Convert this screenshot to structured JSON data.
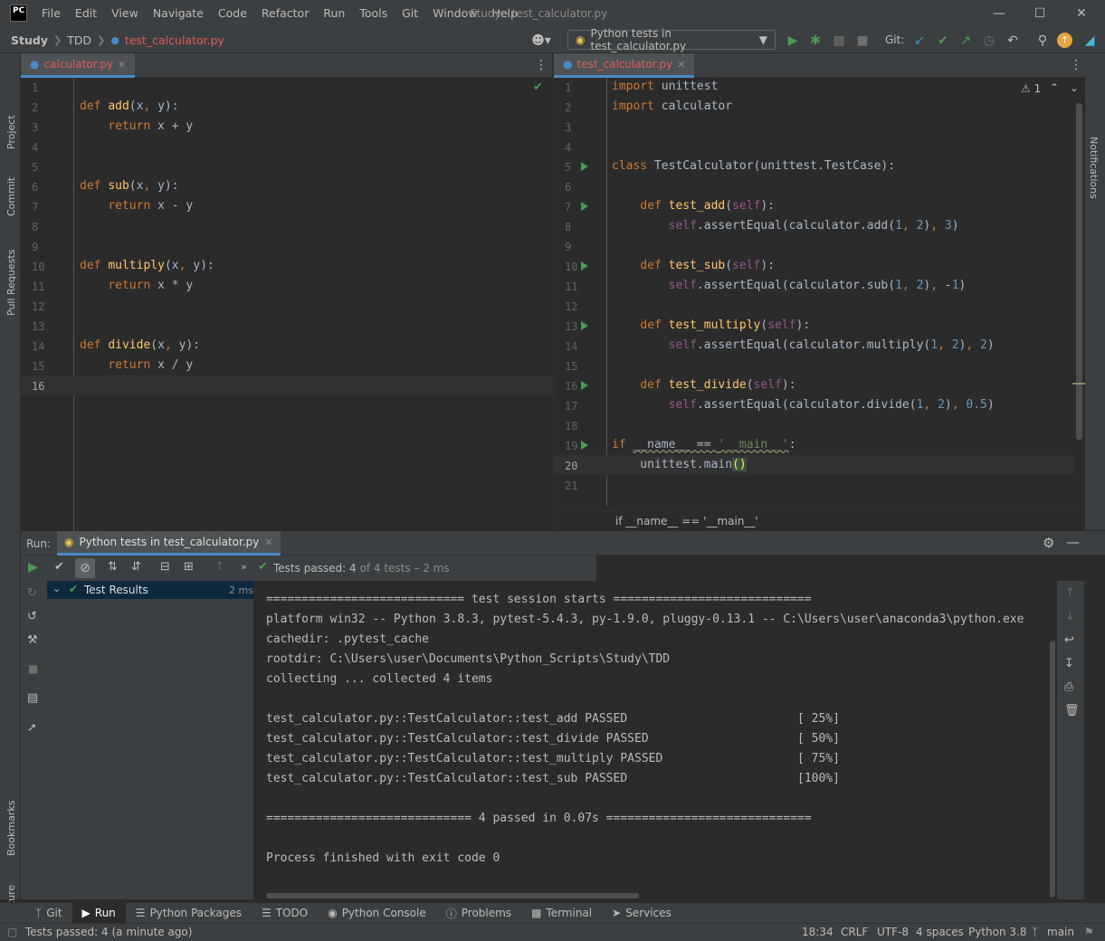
{
  "window": {
    "logo": "PC",
    "title": "Study - test_calculator.py",
    "menu": [
      "File",
      "Edit",
      "View",
      "Navigate",
      "Code",
      "Refactor",
      "Run",
      "Tools",
      "Git",
      "Window",
      "Help"
    ]
  },
  "navbar": {
    "breadcrumb": [
      "Study",
      "TDD",
      "test_calculator.py"
    ],
    "run_config": "Python tests in test_calculator.py",
    "git_label": "Git:"
  },
  "left_stripe": [
    "Project",
    "Commit",
    "Pull Requests",
    "Bookmarks",
    "Structure"
  ],
  "right_stripe": [
    "Notifications"
  ],
  "left_editor": {
    "tab": "calculator.py",
    "lines": [
      "1",
      "2",
      "3",
      "4",
      "5",
      "6",
      "7",
      "8",
      "9",
      "10",
      "11",
      "12",
      "13",
      "14",
      "15",
      "16"
    ]
  },
  "right_editor": {
    "tab": "test_calculator.py",
    "warnings": "1",
    "lines": [
      "1",
      "2",
      "3",
      "4",
      "5",
      "6",
      "7",
      "8",
      "9",
      "10",
      "11",
      "12",
      "13",
      "14",
      "15",
      "16",
      "17",
      "18",
      "19",
      "20",
      "21"
    ],
    "breadcrumb": "if __name__ == '__main__'"
  },
  "run_panel": {
    "label": "Run:",
    "tab": "Python tests in test_calculator.py",
    "status_prefix": "Tests passed:",
    "status_count": "4",
    "status_suffix": "of 4 tests – 2 ms",
    "tree_root": "Test Results",
    "tree_time": "2 ms",
    "console": [
      "============================ test session starts ============================",
      "platform win32 -- Python 3.8.3, pytest-5.4.3, py-1.9.0, pluggy-0.13.1 -- C:\\Users\\user\\anaconda3\\python.exe",
      "cachedir: .pytest_cache",
      "rootdir: C:\\Users\\user\\Documents\\Python_Scripts\\Study\\TDD",
      "collecting ... collected 4 items",
      "",
      "test_calculator.py::TestCalculator::test_add PASSED                        [ 25%]",
      "test_calculator.py::TestCalculator::test_divide PASSED                     [ 50%]",
      "test_calculator.py::TestCalculator::test_multiply PASSED                   [ 75%]",
      "test_calculator.py::TestCalculator::test_sub PASSED                        [100%]",
      "",
      "============================= 4 passed in 0.07s =============================",
      "",
      "Process finished with exit code 0"
    ]
  },
  "tool_windows": [
    "Git",
    "Run",
    "Python Packages",
    "TODO",
    "Python Console",
    "Problems",
    "Terminal",
    "Services"
  ],
  "status_bar": {
    "message": "Tests passed: 4 (a minute ago)",
    "position": "18:34",
    "line_sep": "CRLF",
    "encoding": "UTF-8",
    "indent": "4 spaces",
    "interpreter": "Python 3.8",
    "branch": "main"
  },
  "colors": {
    "accent": "#4a88c7",
    "pass": "#499c54",
    "tab_file": "#d95f54"
  }
}
